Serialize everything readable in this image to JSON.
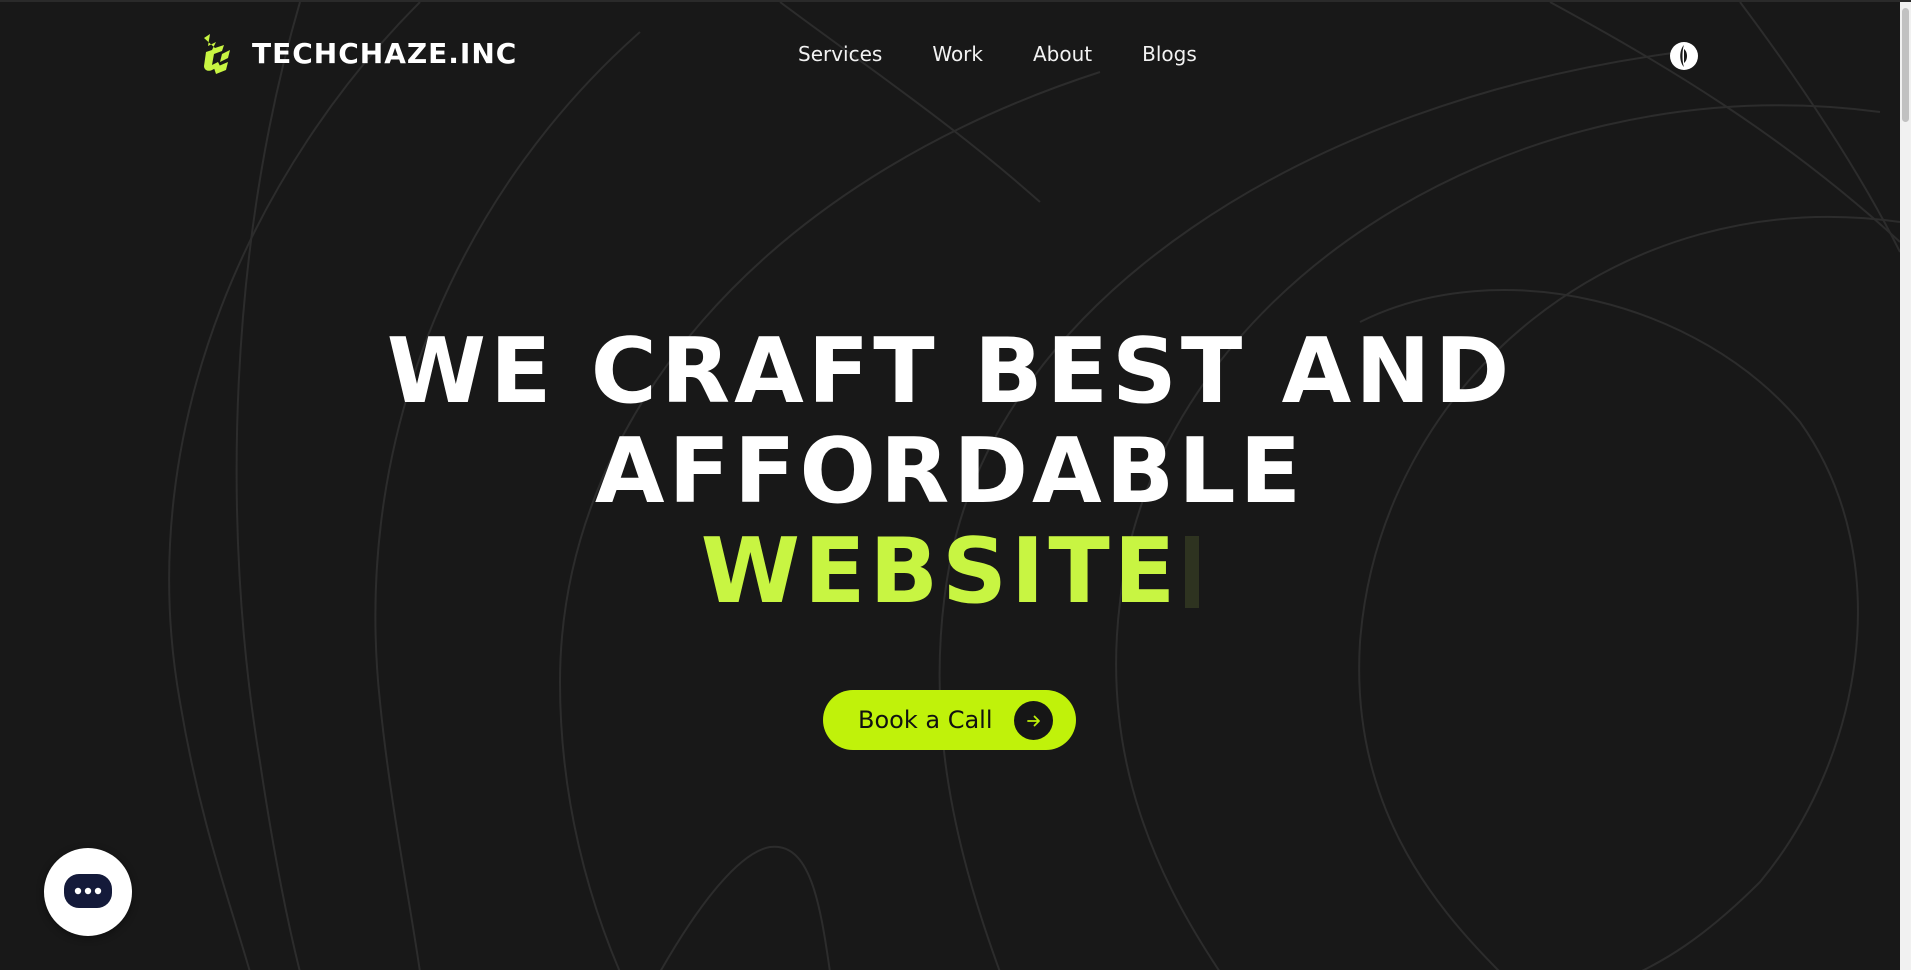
{
  "brand": {
    "name": "TECHCHAZE.INC",
    "logo_icon": "tc-monogram-icon",
    "accent_color": "#c0f20a"
  },
  "nav": {
    "items": [
      {
        "label": "Services"
      },
      {
        "label": "Work"
      },
      {
        "label": "About"
      },
      {
        "label": "Blogs"
      }
    ],
    "theme_toggle_icon": "theme-toggle-icon"
  },
  "hero": {
    "line1": "WE CRAFT BEST AND",
    "line2": "AFFORDABLE",
    "line3_accent": "WEBSITE",
    "headline_color": "#ffffff",
    "accent_color": "#c8f542"
  },
  "cta": {
    "label": "Book a Call",
    "icon": "arrow-right-icon"
  },
  "chat": {
    "icon": "chat-dots-icon"
  },
  "colors": {
    "background": "#181818",
    "lines": "#2c2c2c"
  }
}
